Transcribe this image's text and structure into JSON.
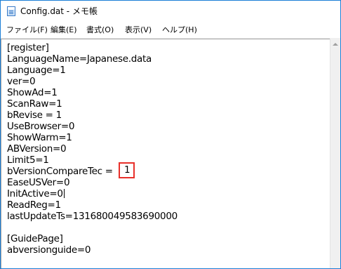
{
  "window": {
    "title": "Config.dat - メモ帳"
  },
  "menu": {
    "items": [
      {
        "label": "ファイル(F)"
      },
      {
        "label": "編集(E)"
      },
      {
        "label": "書式(O)"
      },
      {
        "label": "表示(V)"
      },
      {
        "label": "ヘルプ(H)"
      }
    ]
  },
  "editor": {
    "lines": [
      "[register]",
      "LanguageName=Japanese.data",
      "Language=1",
      "ver=0",
      "ShowAd=1",
      "ScanRaw=1",
      "bRevise = 1",
      "UseBrowser=0",
      "ShowWarm=1",
      "ABVersion=0",
      "Limit5=1",
      "bVersionCompareTec = ",
      "EaseUSVer=0",
      "InitActive=0",
      "ReadReg=1",
      "lastUpdateTs=131680049583690000",
      "",
      "[GuidePage]",
      "abversionguide=0"
    ],
    "highlighted_value": "1",
    "highlight_color": "#e8302a"
  },
  "icons": {
    "app": "notepad-icon",
    "scroll_up": "scroll-up-arrow-icon"
  }
}
